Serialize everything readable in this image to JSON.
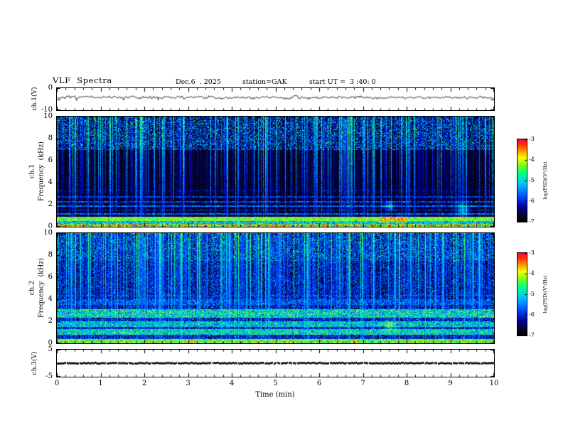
{
  "header": {
    "title": "VLF  Spectra",
    "date": "Dec.6  . 2025",
    "station": "station=GAK",
    "start": "start UT =  3 :40: 0"
  },
  "axes": {
    "x": {
      "label": "Time  (min)",
      "min": 0,
      "max": 10,
      "ticks": [
        "0",
        "1",
        "2",
        "3",
        "4",
        "5",
        "6",
        "7",
        "8",
        "9",
        "10"
      ]
    },
    "ch1_wave": {
      "unit_label": "ch.1(V)",
      "tick_labels": [
        "0",
        "-10"
      ],
      "y_min": -10,
      "y_max": 0
    },
    "ch1_spec": {
      "ch_label": "ch.1",
      "freq_label": "Frequency  (kHz)",
      "ticks": [
        "10",
        "8",
        "6",
        "4",
        "2",
        "0"
      ],
      "y_min": 0,
      "y_max": 10
    },
    "ch2_spec": {
      "ch_label": "ch.2",
      "freq_label": "Frequency  (kHz)",
      "ticks": [
        "10",
        "8",
        "6",
        "4",
        "2",
        "0"
      ],
      "y_min": 0,
      "y_max": 10
    },
    "ch3_wave": {
      "unit_label": "ch.3(V)",
      "tick_labels": [
        "5",
        "-5"
      ],
      "y_min": -5,
      "y_max": 5
    }
  },
  "colorbars": [
    {
      "ticks": [
        "-3",
        "-4",
        "-5",
        "-6",
        "-7"
      ],
      "label": "log(PSD)(V²/Hz)",
      "z_min": -7,
      "z_max": -3
    },
    {
      "ticks": [
        "-3",
        "-4",
        "-5",
        "-6",
        "-7"
      ],
      "label": "log(PSD)(V²/Hz)",
      "z_min": -7,
      "z_max": -3
    }
  ],
  "palette": {
    "stops": [
      [
        0.0,
        0,
        0,
        0
      ],
      [
        0.08,
        5,
        5,
        50
      ],
      [
        0.18,
        0,
        0,
        160
      ],
      [
        0.3,
        0,
        70,
        255
      ],
      [
        0.45,
        0,
        190,
        255
      ],
      [
        0.58,
        0,
        255,
        140
      ],
      [
        0.68,
        110,
        255,
        30
      ],
      [
        0.78,
        255,
        255,
        0
      ],
      [
        0.86,
        255,
        150,
        0
      ],
      [
        0.93,
        255,
        60,
        0
      ],
      [
        1.0,
        255,
        0,
        60
      ]
    ]
  },
  "chart_data": [
    {
      "type": "line",
      "panel": "ch1_waveform",
      "title": "ch.1(V) time series",
      "xlabel": "Time (min)",
      "x_range": [
        0,
        10
      ],
      "ylabel": "ch.1(V)",
      "y_range": [
        -10,
        0
      ],
      "description": "continuous noisy trace centered near -4 V, peak-to-peak about 2 V, occasional short spikes",
      "model": {
        "seed": 7,
        "center": -4.2,
        "noise_v": 0.6,
        "spike_prob": 0.03,
        "spike_v": 1.4
      }
    },
    {
      "type": "heatmap",
      "panel": "ch1_spectrogram",
      "title": "ch.1 VLF spectrogram",
      "xlabel": "Time (min)",
      "x_range": [
        0,
        10
      ],
      "ylabel": "Frequency (kHz)",
      "y_range": [
        0,
        10
      ],
      "z_label": "log(PSD)(V²/Hz)",
      "z_range": [
        -7,
        -3
      ],
      "features": [
        "dark background near -7 between 3.5 and 7 kHz",
        "raised speckled noise floor near -6.3 above 7 kHz (green/cyan speckle)",
        "frequent narrow vertical broadband sferic streaks reaching -5.5 to -4.5",
        "thin horizontal lines near 1.2, 1.55, 1.9, 2.3, 2.75 and 3.3 kHz at about -5.7 to -6.2",
        "bright band 0.55-0.95 kHz near -4.3 with orange/red enhancement near 7.4-8.0 min",
        "bright multicolour edge band below 0.3 kHz near -4.1"
      ],
      "model": {
        "seed": 101,
        "noise_floor": -6.85,
        "sigma_base": 0.28,
        "high_band": {
          "f_min": 7.0,
          "base": -6.35,
          "sigma": 0.9
        },
        "streaks": {
          "probability": 0.5,
          "big_prob": 0.42,
          "big_amp": [
            1.0,
            2.3
          ],
          "small_amp": [
            0.25,
            0.8
          ]
        },
        "h_lines": [
          {
            "f": 1.2,
            "w": 0.07,
            "level": -5.7
          },
          {
            "f": 1.55,
            "w": 0.06,
            "level": -5.95
          },
          {
            "f": 1.9,
            "w": 0.07,
            "level": -5.65
          },
          {
            "f": 2.3,
            "w": 0.06,
            "level": -5.9
          },
          {
            "f": 2.75,
            "w": 0.06,
            "level": -6.05
          },
          {
            "f": 3.3,
            "w": 0.05,
            "level": -6.25
          }
        ],
        "bands": [
          {
            "f_min": 0.0,
            "f_max": 0.28,
            "level": -4.15,
            "sigma": 0.75
          },
          {
            "f_min": 0.28,
            "f_max": 0.55,
            "level": -5.1,
            "sigma": 0.5
          },
          {
            "f_min": 0.55,
            "f_max": 0.95,
            "level": -4.3,
            "sigma": 0.42
          }
        ],
        "hot_spot": {
          "t_min": 7.35,
          "t_max": 8.0,
          "f_min": 0.45,
          "f_max": 1.0,
          "boost": 0.75
        },
        "blobs": [
          {
            "t": 7.6,
            "f": 1.9,
            "rt": 0.1,
            "rf": 0.4,
            "boost": 1.2
          },
          {
            "t": 9.3,
            "f": 1.6,
            "rt": 0.14,
            "rf": 0.6,
            "boost": 1.1
          }
        ]
      }
    },
    {
      "type": "heatmap",
      "panel": "ch2_spectrogram",
      "title": "ch.2 VLF spectrogram",
      "xlabel": "Time (min)",
      "x_range": [
        0,
        10
      ],
      "ylabel": "Frequency (kHz)",
      "y_range": [
        0,
        10
      ],
      "z_label": "log(PSD)(V²/Hz)",
      "z_range": [
        -7,
        -3
      ],
      "features": [
        "overall brighter blue noise floor near -6.3 with dense cyan speckle",
        "many vertical sferic streaks reaching -5.5 to -4.8",
        "broad green horizontal bands at 0.8-1.35, 1.5-2.05 and 2.35-3.15 kHz near -5.0",
        "weaker band 3.5-4.05 kHz near -5.8 and a thin line near 4.35 kHz",
        "bright yellow-green edge band below 0.45 kHz near -4.3"
      ],
      "model": {
        "seed": 202,
        "noise_floor": -6.3,
        "sigma_base": 0.58,
        "high_band": {
          "f_min": 7.5,
          "base": -6.05,
          "sigma": 0.7
        },
        "streaks": {
          "probability": 0.55,
          "big_prob": 0.35,
          "big_amp": [
            0.8,
            1.9
          ],
          "small_amp": [
            0.2,
            0.7
          ]
        },
        "h_lines": [
          {
            "f": 4.35,
            "w": 0.06,
            "level": -5.9
          }
        ],
        "bands": [
          {
            "f_min": 0.0,
            "f_max": 0.45,
            "level": -4.3,
            "sigma": 0.55
          },
          {
            "f_min": 0.8,
            "f_max": 1.35,
            "level": -5.0,
            "sigma": 0.5
          },
          {
            "f_min": 1.5,
            "f_max": 2.05,
            "level": -5.15,
            "sigma": 0.5
          },
          {
            "f_min": 2.35,
            "f_max": 3.15,
            "level": -5.0,
            "sigma": 0.55
          },
          {
            "f_min": 3.5,
            "f_max": 4.05,
            "level": -5.8,
            "sigma": 0.45
          }
        ],
        "blobs": [
          {
            "t": 7.6,
            "f": 1.6,
            "rt": 0.12,
            "rf": 0.5,
            "boost": 0.9
          }
        ]
      }
    },
    {
      "type": "line",
      "panel": "ch3_waveform",
      "title": "ch.3(V) time series",
      "xlabel": "Time (min)",
      "x_range": [
        0,
        10
      ],
      "ylabel": "ch.3(V)",
      "y_range": [
        -5,
        5
      ],
      "description": "flat thick dark trace at 0 V for the entire 10 minute record",
      "model": {
        "seed": 9,
        "center": 0,
        "thickness": 2.6,
        "gap_prob": 0.05
      }
    }
  ]
}
